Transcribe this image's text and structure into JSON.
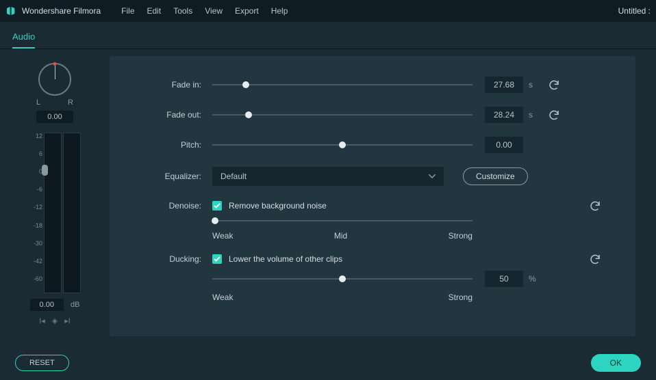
{
  "app": {
    "name": "Wondershare Filmora",
    "project": "Untitled :"
  },
  "menu": [
    "File",
    "Edit",
    "Tools",
    "View",
    "Export",
    "Help"
  ],
  "tab": {
    "audio": "Audio"
  },
  "pan": {
    "l": "L",
    "r": "R",
    "value": "0.00"
  },
  "vu": {
    "ticks": [
      "12",
      "6",
      "0",
      "-6",
      "-12",
      "-18",
      "-30",
      "-42",
      "-60",
      ""
    ],
    "value": "0.00",
    "unit": "dB"
  },
  "labels": {
    "fade_in": "Fade in:",
    "fade_out": "Fade out:",
    "pitch": "Pitch:",
    "equalizer": "Equalizer:",
    "denoise": "Denoise:",
    "ducking": "Ducking:"
  },
  "fade_in": {
    "value": "27.68",
    "unit": "s",
    "pos": 13
  },
  "fade_out": {
    "value": "28.24",
    "unit": "s",
    "pos": 14
  },
  "pitch": {
    "value": "0.00",
    "pos": 50
  },
  "equalizer": {
    "selected": "Default",
    "customize": "Customize"
  },
  "denoise": {
    "checkbox_label": "Remove background noise",
    "pos": 1,
    "weak": "Weak",
    "mid": "Mid",
    "strong": "Strong"
  },
  "ducking": {
    "checkbox_label": "Lower the volume of other clips",
    "pos": 50,
    "value": "50",
    "unit": "%",
    "weak": "Weak",
    "strong": "Strong"
  },
  "footer": {
    "reset": "RESET",
    "ok": "OK"
  }
}
